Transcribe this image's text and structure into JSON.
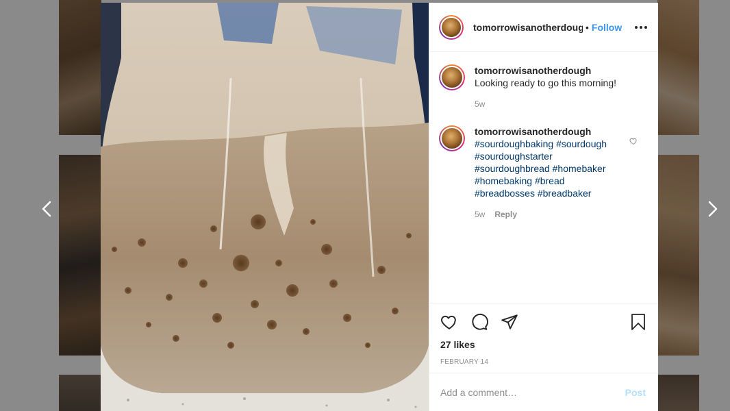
{
  "post": {
    "username": "tomorrowisanotherdough",
    "header_username_display": "tomorrowisanotherdoug",
    "separator": "•",
    "follow_label": "Follow",
    "caption": {
      "username": "tomorrowisanotherdough",
      "text": "Looking ready to go this morning!",
      "age": "5w"
    },
    "comments": [
      {
        "username": "tomorrowisanotherdough",
        "text": "#sourdoughbaking #sourdough #sourdoughstarter #sourdoughbread #homebaker #homebaking #bread #breadbosses #breadbaker",
        "age": "5w",
        "reply_label": "Reply"
      }
    ],
    "likes": "27 likes",
    "date": "FEBRUARY 14",
    "comment_input": {
      "placeholder": "Add a comment…",
      "value": ""
    },
    "post_label": "Post"
  },
  "icons": {
    "prev": "chevron-left-icon",
    "next": "chevron-right-icon",
    "like": "heart-icon",
    "comment": "comment-bubble-icon",
    "share": "paper-plane-icon",
    "save": "bookmark-icon",
    "more": "more-horizontal-icon",
    "comment_like": "heart-icon"
  },
  "colors": {
    "accent": "#3897f0",
    "hashtag": "#00376b",
    "muted": "#8e8e8e",
    "post_disabled": "#b2dffc"
  }
}
